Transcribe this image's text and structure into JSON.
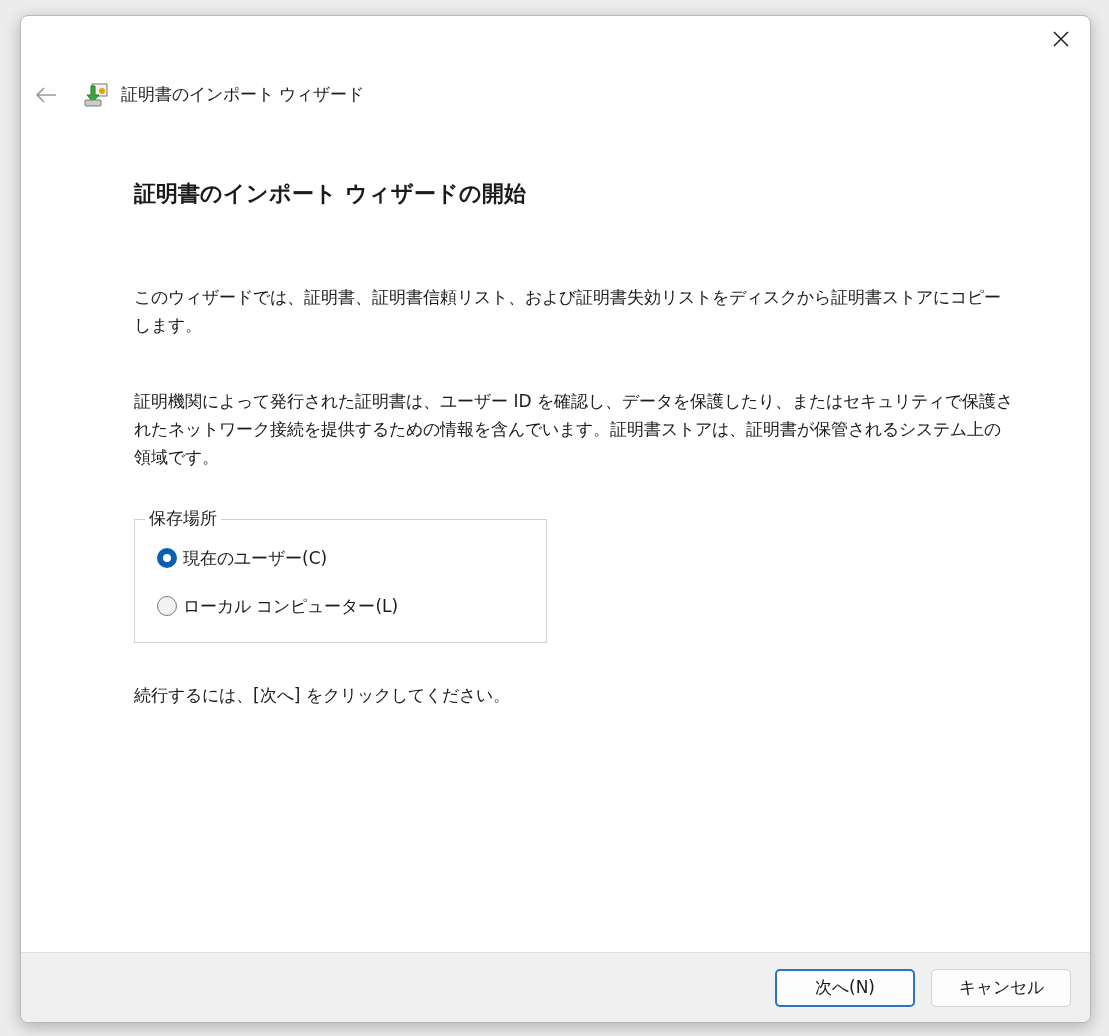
{
  "window": {
    "title": "証明書のインポート ウィザード"
  },
  "heading": "証明書のインポート ウィザードの開始",
  "paragraphs": [
    "このウィザードでは、証明書、証明書信頼リスト、および証明書失効リストをディスクから証明書ストアにコピーします。",
    "証明機関によって発行された証明書は、ユーザー ID を確認し、データを保護したり、またはセキュリティで保護されたネットワーク接続を提供するための情報を含んでいます。証明書ストアは、証明書が保管されるシステム上の領域です。"
  ],
  "store_location": {
    "label": "保存場所",
    "options": [
      {
        "label": "現在のユーザー(C)",
        "selected": true
      },
      {
        "label": "ローカル コンピューター(L)",
        "selected": false
      }
    ]
  },
  "instruction": "続行するには、[次へ] をクリックしてください。",
  "buttons": [
    {
      "label": "次へ(N)",
      "default": true
    },
    {
      "label": "キャンセル",
      "default": false
    }
  ]
}
